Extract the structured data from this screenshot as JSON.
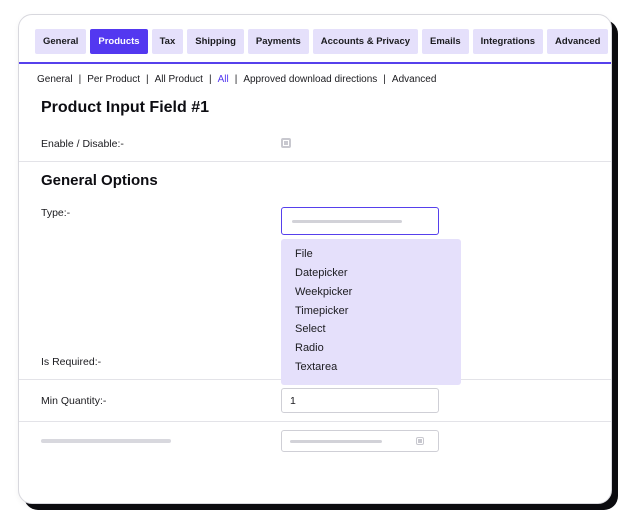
{
  "tabs": {
    "items": [
      {
        "label": "General"
      },
      {
        "label": "Products"
      },
      {
        "label": "Tax"
      },
      {
        "label": "Shipping"
      },
      {
        "label": "Payments"
      },
      {
        "label": "Accounts & Privacy"
      },
      {
        "label": "Emails"
      },
      {
        "label": "Integrations"
      },
      {
        "label": "Advanced"
      }
    ],
    "active_index": 1
  },
  "subtabs": {
    "items": [
      {
        "label": "General"
      },
      {
        "label": "Per Product"
      },
      {
        "label": "All Product"
      },
      {
        "label": "All"
      },
      {
        "label": "Approved download directions"
      },
      {
        "label": "Advanced"
      }
    ],
    "active_index": 3
  },
  "headings": {
    "product_input_field": "Product Input Field #1",
    "general_options": "General Options"
  },
  "form": {
    "enable_label": "Enable  / Disable:-",
    "type_label": "Type:-",
    "type_options": [
      "File",
      "Datepicker",
      "Weekpicker",
      "Timepicker",
      "Select",
      "Radio",
      "Textarea"
    ],
    "is_required_label": "Is Required:-",
    "min_qty_label": "Min Quantity:-",
    "min_qty_value": "1"
  }
}
